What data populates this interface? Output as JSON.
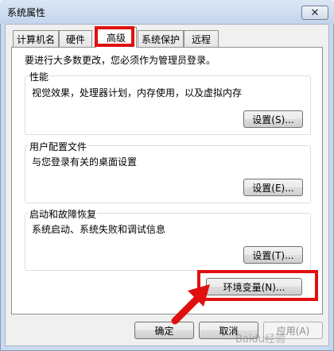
{
  "window": {
    "title": "系统属性",
    "close_glyph": "✕"
  },
  "tabs": [
    {
      "label": "计算机名"
    },
    {
      "label": "硬件"
    },
    {
      "label": "高级"
    },
    {
      "label": "系统保护"
    },
    {
      "label": "远程"
    }
  ],
  "notice": "要进行大多数更改，您必须作为管理员登录。",
  "performance": {
    "title": "性能",
    "desc": "视觉效果，处理器计划，内存使用，以及虚拟内存",
    "button": "设置(S)..."
  },
  "user_profiles": {
    "title": "用户配置文件",
    "desc": "与您登录有关的桌面设置",
    "button": "设置(E)..."
  },
  "startup": {
    "title": "启动和故障恢复",
    "desc": "系统启动、系统失败和调试信息",
    "button": "设置(T)..."
  },
  "env_button": "环境变量(N)...",
  "footer": {
    "ok": "确定",
    "cancel": "取消",
    "apply": "应用(A)"
  },
  "watermark": "Baidu经验",
  "colors": {
    "highlight": "#e01010",
    "arrow": "#e01010"
  }
}
